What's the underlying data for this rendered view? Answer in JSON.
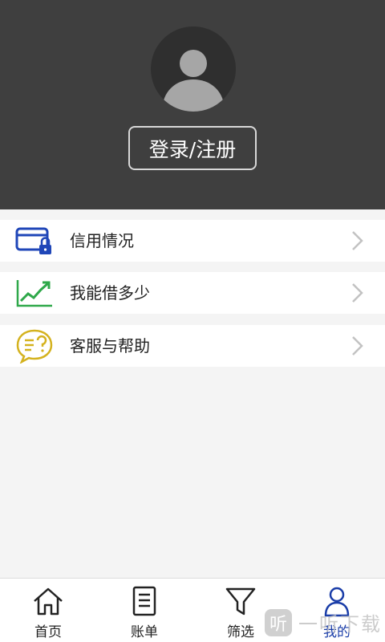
{
  "header": {
    "login_label": "登录/注册"
  },
  "menu": {
    "items": [
      {
        "label": "信用情况",
        "icon": "credit-card-lock-icon"
      },
      {
        "label": "我能借多少",
        "icon": "trend-chart-icon"
      },
      {
        "label": "客服与帮助",
        "icon": "chat-question-icon"
      }
    ]
  },
  "tabbar": {
    "tabs": [
      {
        "label": "首页",
        "icon": "home-icon"
      },
      {
        "label": "账单",
        "icon": "document-icon"
      },
      {
        "label": "筛选",
        "icon": "filter-icon"
      },
      {
        "label": "我的",
        "icon": "user-icon",
        "active": true
      }
    ]
  },
  "watermark": {
    "badge": "听",
    "text": "一听下载"
  },
  "colors": {
    "header_bg": "#3f3f3f",
    "active_tab": "#1a3da8",
    "card_icon": "#1f46b8",
    "trend_icon": "#2fa84a",
    "help_icon": "#d4b21e"
  }
}
